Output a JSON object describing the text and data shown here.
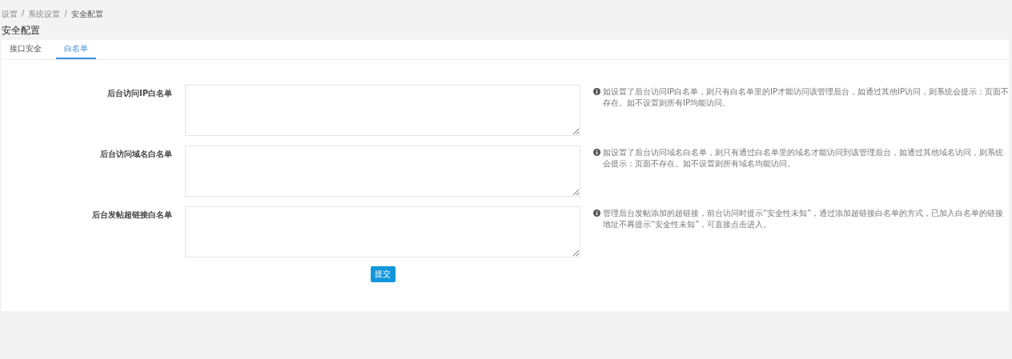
{
  "breadcrumb": {
    "items": [
      "设置",
      "系统设置",
      "安全配置"
    ],
    "separator": "/"
  },
  "page_title": "安全配置",
  "tabs": [
    {
      "label": "接口安全",
      "selected": false
    },
    {
      "label": "白名单",
      "selected": true
    }
  ],
  "form": {
    "fields": [
      {
        "label": "后台访问IP白名单",
        "help": "如设置了后台访问IP白名单，则只有白名单里的IP才能访问该管理后台，如通过其他IP访问，则系统会提示：页面不存在。如不设置则所有IP均能访问。"
      },
      {
        "label": "后台访问域名白名单",
        "help": "如设置了后台访问域名白名单，则只有通过白名单里的域名才能访问到该管理后台，如通过其他域名访问，则系统会提示：页面不存在。如不设置则所有域名均能访问。"
      },
      {
        "label": "后台发帖超链接白名单",
        "help": "管理后台发帖添加的超链接，前台访问时提示“安全性未知”，通过添加超链接白名单的方式，已加入白名单的链接地址不再提示“安全性未知”，可直接点击进入。"
      }
    ],
    "submit": "提交"
  }
}
